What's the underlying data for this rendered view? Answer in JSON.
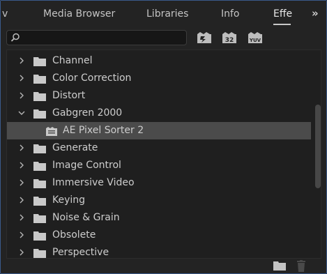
{
  "tabs": [
    {
      "label": "v"
    },
    {
      "label": "Media Browser"
    },
    {
      "label": "Libraries"
    },
    {
      "label": "Info"
    },
    {
      "label": "Effe"
    }
  ],
  "tab_overflow": "»",
  "search": {
    "placeholder": "",
    "value": ""
  },
  "toolbar": {
    "accelerated_label": "",
    "bit32_label": "32",
    "yuv_label": "YUV"
  },
  "tree": {
    "items": [
      {
        "label": "Channel"
      },
      {
        "label": "Color Correction"
      },
      {
        "label": "Distort"
      },
      {
        "label": "Gabgren 2000"
      },
      {
        "label": "AE Pixel Sorter 2"
      },
      {
        "label": "Generate"
      },
      {
        "label": "Image Control"
      },
      {
        "label": "Immersive Video"
      },
      {
        "label": "Keying"
      },
      {
        "label": "Noise & Grain"
      },
      {
        "label": "Obsolete"
      },
      {
        "label": "Perspective"
      }
    ]
  },
  "colors": {
    "panel_bg": "#232323",
    "list_bg": "#1f1f1f",
    "selected_row": "#4b4b4b",
    "panel_border": "#3a5a8c",
    "text": "#cdcdcd"
  }
}
